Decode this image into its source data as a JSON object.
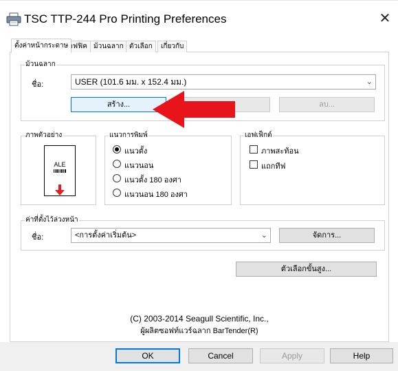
{
  "window": {
    "title": "TSC TTP-244 Pro Printing Preferences",
    "close_glyph": "✕"
  },
  "tabs": [
    {
      "label": "ตั้งค่าหน้ากระดาษ",
      "active": true
    },
    {
      "label": "กราฟฟิค"
    },
    {
      "label": "ม้วนฉลาก"
    },
    {
      "label": "ตัวเลือก"
    },
    {
      "label": "เกี่ยวกับ"
    }
  ],
  "stock": {
    "legend": "ม้วนฉลาก",
    "name_label": "ชื่อ:",
    "name_value": "USER (101.6 มม. x 152.4 มม.)",
    "create_button": "สร้าง...",
    "delete_button": "ลบ..."
  },
  "preview": {
    "legend": "ภาพตัวอย่าง",
    "sample_text": "ALE"
  },
  "orientation": {
    "legend": "แนวการพิมพ์",
    "options": [
      {
        "label": "แนวตั้ง",
        "selected": true
      },
      {
        "label": "แนวนอน",
        "selected": false
      },
      {
        "label": "แนวตั้ง 180 องศา",
        "selected": false
      },
      {
        "label": "แนวนอน 180 องศา",
        "selected": false
      }
    ]
  },
  "effects": {
    "legend": "เอฟเฟ็กต์",
    "options": [
      {
        "label": "ภาพสะท้อน",
        "checked": false
      },
      {
        "label": "แถกทีฟ",
        "checked": false
      }
    ]
  },
  "presets": {
    "legend": "ค่าที่ตั้งไว้ล่วงหน้า",
    "name_label": "ชื่อ:",
    "name_value": "<การตั้งค่าเริ่มต้น>",
    "manage_button": "จัดการ..."
  },
  "advanced_button": "ตัวเลือกขั้นสูง...",
  "copyright": {
    "line1": "(C) 2003-2014 Seagull Scientific, Inc.,",
    "line2": "ผู้ผลิตซอฟท์แวร์ฉลาก BarTender(R)"
  },
  "footer": {
    "ok": "OK",
    "cancel": "Cancel",
    "apply": "Apply",
    "help": "Help"
  },
  "colors": {
    "accent": "#0078d7",
    "annotation_arrow": "#e8141b"
  }
}
